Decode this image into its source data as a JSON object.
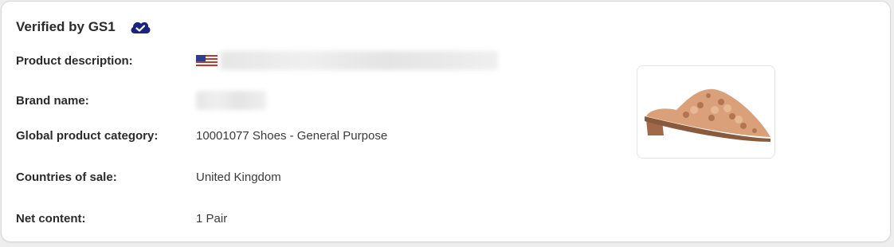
{
  "card": {
    "title": "Verified by GS1",
    "badge_icon": "cloud-check-icon",
    "accent_color": "#1a237e"
  },
  "fields": [
    {
      "label": "Product description:",
      "value": "",
      "flag_icon": "us-flag-icon",
      "value_redacted": true
    },
    {
      "label": "Brand name:",
      "value": "",
      "value_redacted": true
    },
    {
      "label": "Global product category:",
      "value": "10001077 Shoes - General Purpose"
    },
    {
      "label": "Countries of sale:",
      "value": "United Kingdom"
    },
    {
      "label": "Net content:",
      "value": "1 Pair"
    }
  ],
  "product_image": {
    "icon": "shoe-product-image"
  }
}
